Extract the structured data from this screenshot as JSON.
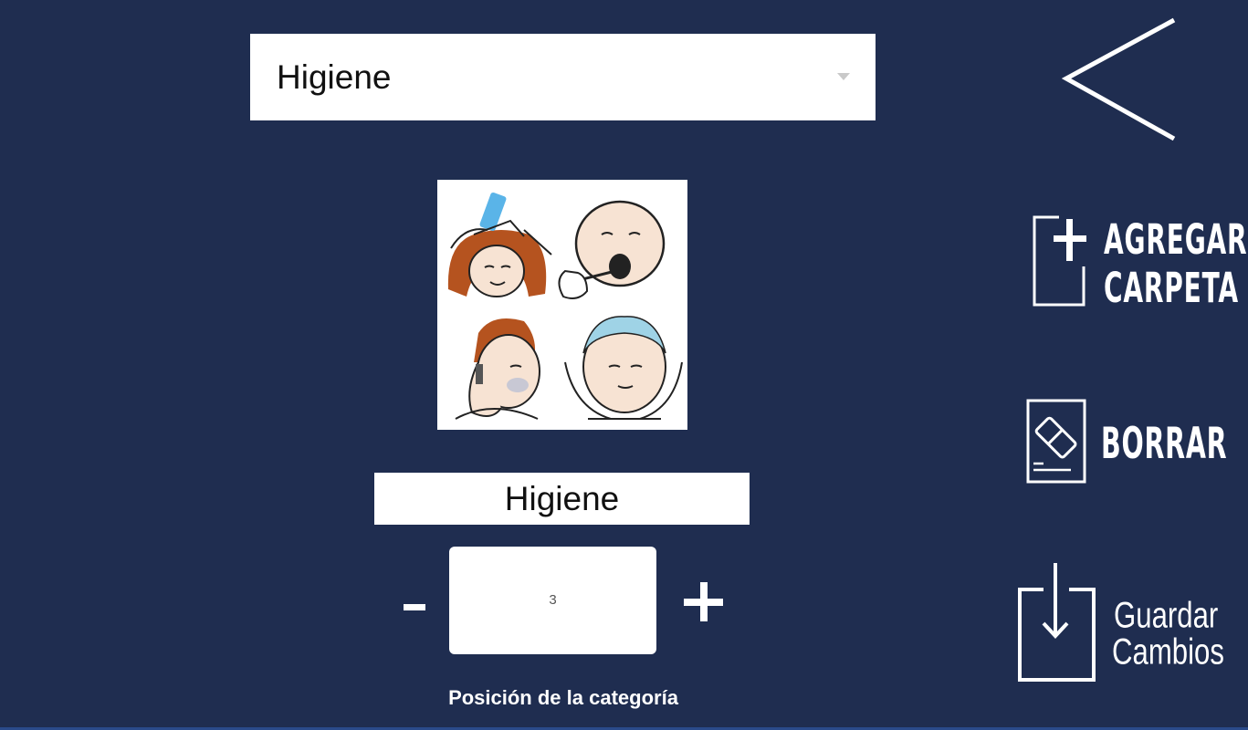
{
  "category_select": {
    "selected": "Higiene"
  },
  "pictogram": {
    "icon": "hygiene-pictogram-icon"
  },
  "name_field": {
    "value": "Higiene"
  },
  "position": {
    "minus_label": "-",
    "plus_label": "+",
    "value": "3",
    "label": "Posición de la categoría"
  },
  "actions": {
    "back_icon": "back-chevron-icon",
    "add_folder_line1": "AGREGAR",
    "add_folder_line2": "CARPETA",
    "delete_label": "BORRAR",
    "save_line1": "Guardar",
    "save_line2": "Cambios"
  },
  "colors": {
    "background": "#1f2d50",
    "field_background": "#ffffff",
    "action_foreground": "#ffffff"
  }
}
